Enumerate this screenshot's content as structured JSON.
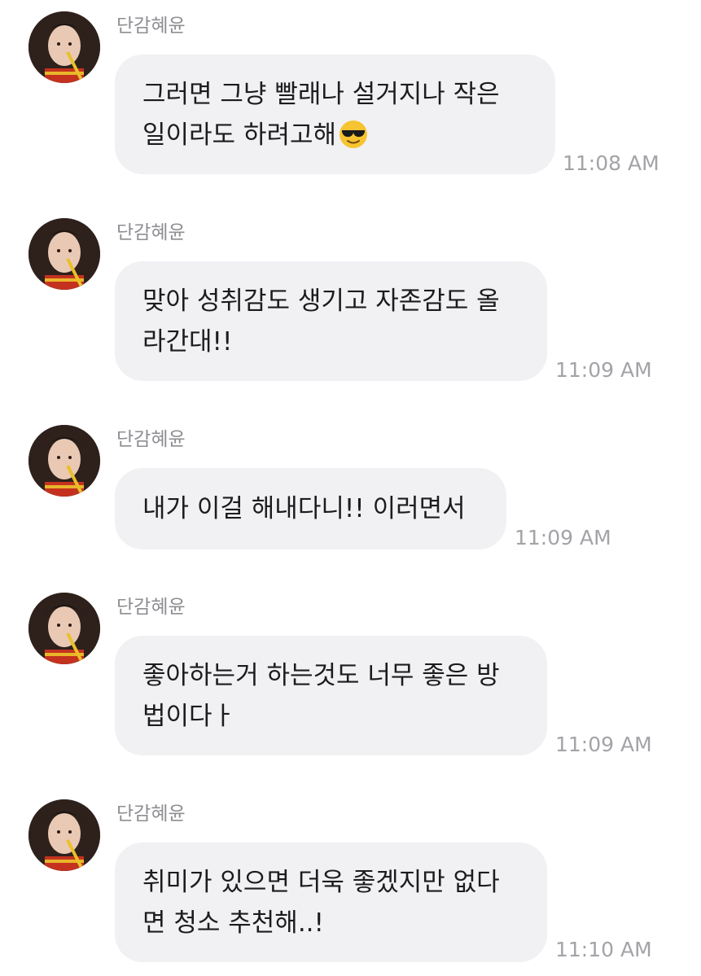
{
  "conversation": {
    "messages": [
      {
        "sender": "단감혜윤",
        "lines": [
          "그러면 그냥 빨래나 설거지나 작은",
          "일이라도 하려고해"
        ],
        "emoji": "sunglasses-face",
        "time": "11:08 AM"
      },
      {
        "sender": "단감혜윤",
        "lines": [
          "맞아 성취감도 생기고 자존감도 올",
          "라간대!!"
        ],
        "time": "11:09 AM"
      },
      {
        "sender": "단감혜윤",
        "lines": [
          "내가 이걸 해내다니!! 이러면서"
        ],
        "time": "11:09 AM"
      },
      {
        "sender": "단감혜윤",
        "lines": [
          "좋아하는거 하는것도 너무 좋은 방",
          "법이다ㅏ"
        ],
        "time": "11:09 AM"
      },
      {
        "sender": "단감혜윤",
        "lines": [
          "취미가 있으면 더욱 좋겠지만 없다",
          "면 청소 추천해..!"
        ],
        "time": "11:10 AM"
      }
    ]
  },
  "colors": {
    "bubble": "#f1f1f4",
    "text": "#1c1c1e",
    "sender": "#8e8e93",
    "time": "#a3a3a8"
  }
}
